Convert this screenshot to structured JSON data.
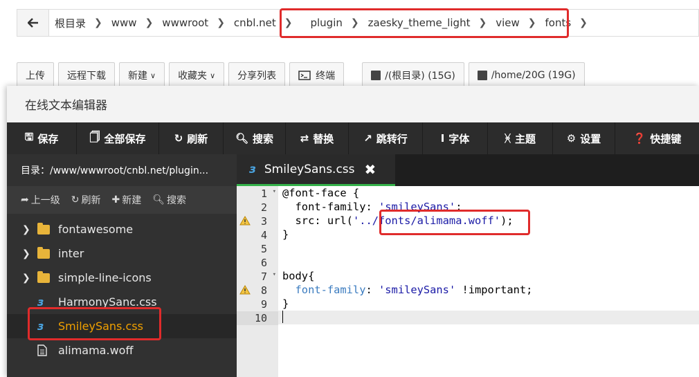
{
  "breadcrumb": {
    "items": [
      "根目录",
      "www",
      "wwwroot",
      "cnbl.net",
      "plugin",
      "zaesky_theme_light",
      "view",
      "fonts"
    ]
  },
  "toolbar": {
    "upload": "上传",
    "remote_download": "远程下载",
    "new": "新建",
    "favorites": "收藏夹",
    "share_list": "分享列表",
    "terminal": "终端",
    "disk_root": "/(根目录) (15G)",
    "disk_home": "/home/20G (19G)"
  },
  "editor": {
    "window_title": "在线文本编辑器",
    "menu": [
      "保存",
      "全部保存",
      "刷新",
      "搜索",
      "替换",
      "跳转行",
      "字体",
      "主题",
      "设置",
      "快捷键"
    ],
    "sidebar": {
      "path": "目录：/www/wwwroot/cnbl.net/plugin...",
      "tools": [
        "上一级",
        "刷新",
        "新建",
        "搜索"
      ],
      "items": [
        {
          "name": "fontawesome",
          "type": "folder"
        },
        {
          "name": "inter",
          "type": "folder"
        },
        {
          "name": "simple-line-icons",
          "type": "folder"
        },
        {
          "name": "HarmonySanc.css",
          "type": "css"
        },
        {
          "name": "SmileySans.css",
          "type": "css",
          "active": true
        },
        {
          "name": "alimama.woff",
          "type": "file"
        }
      ]
    },
    "tab": {
      "filename": "SmileySans.css",
      "close": "✖"
    },
    "code": {
      "line_numbers": [
        "1",
        "2",
        "3",
        "4",
        "5",
        "6",
        "7",
        "8",
        "9",
        "10"
      ],
      "l1_a": "@font-face {",
      "l2_a": "  font-family: ",
      "l2_b": "'smileySans'",
      "l2_c": ";",
      "l3_a": "  src: url(",
      "l3_b": "'../fonts/alimama.woff'",
      "l3_c": ");",
      "l4": "}",
      "l7": "body{",
      "l8_a": "  font-family",
      "l8_b": ": ",
      "l8_c": "'smileySans'",
      "l8_d": " !important;",
      "l9": "}"
    }
  },
  "colors": {
    "highlight_red": "#e02b2b",
    "active_file": "#f0a000",
    "menu_bg": "#2c2c2c",
    "tab_underline": "#35b24a"
  }
}
